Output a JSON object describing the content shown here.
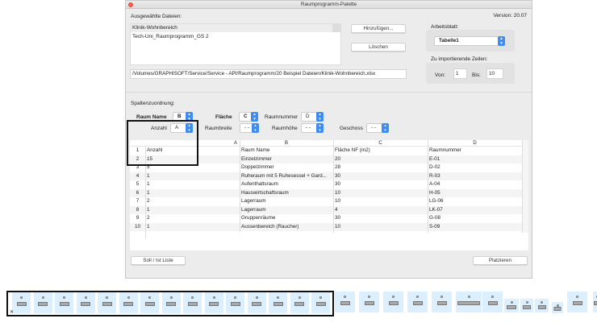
{
  "window": {
    "title": "Raumprogramm-Palette",
    "version": "Version: 20.07"
  },
  "files": {
    "label": "Ausgewählte Dateien:",
    "items": [
      "Klinik-Wohnbereich",
      "Tech-Uni_Raumprogramm_GS 2"
    ],
    "path": "/Volumes/GRAPHISOFT/Service/Service - API/Raumprogramm/20 Beispiel Dateien/Klinik-Wohnbereich.xlsx",
    "add_button": "Hinzufügen...",
    "delete_button": "Löschen"
  },
  "sheet": {
    "label": "Arbeitsblatt:",
    "value": "Tabelle1"
  },
  "rows_import": {
    "label": "Zu importierende Zeilen:",
    "from_label": "Von:",
    "from": "1",
    "to_label": "Bis:",
    "to": "10"
  },
  "mapping": {
    "label": "Spaltenzuordnung:",
    "raum_name": {
      "label": "Raum Name",
      "value": "B"
    },
    "flaeche": {
      "label": "Fläche",
      "value": "C"
    },
    "raumnummer": {
      "label": "Raumnummer",
      "value": "D"
    },
    "anzahl": {
      "label": "Anzahl",
      "value": "A"
    },
    "raumbreite": {
      "label": "Raumbreite",
      "value": "- -"
    },
    "raumhoehe": {
      "label": "Raumhöhe",
      "value": "- -"
    },
    "geschoss": {
      "label": "Geschoss",
      "value": "- -"
    }
  },
  "table": {
    "columns": [
      "A",
      "B",
      "C",
      "D"
    ],
    "rows": [
      [
        "1",
        "Anzahl",
        "Raum Name",
        "Fläche NF (m2)",
        "Raumnummer"
      ],
      [
        "2",
        "15",
        "Einzelzimmer",
        "20",
        "E-01"
      ],
      [
        "3",
        "5",
        "Doppelzimmer",
        "28",
        "D-02"
      ],
      [
        "4",
        "1",
        "Ruheraum mit 5 Ruhesessel + Gard...",
        "30",
        "R-03"
      ],
      [
        "5",
        "1",
        "Aufenthaltsraum",
        "30",
        "A-04"
      ],
      [
        "6",
        "1",
        "Hauswirtschaftsraum",
        "10",
        "H-05"
      ],
      [
        "7",
        "2",
        "Lagerraum",
        "10",
        "LG-06"
      ],
      [
        "8",
        "1",
        "Lagerraum",
        "4",
        "LK-07"
      ],
      [
        "9",
        "2",
        "Gruppenräume",
        "30",
        "G-08"
      ],
      [
        "10",
        "1",
        "Aussenbereich (Raucher)",
        "10",
        "S-09"
      ]
    ]
  },
  "buttons": {
    "soll_ist": "Soll / Ist Liste",
    "place": "Platzieren"
  },
  "colors": {
    "accent": "#3b8cf5",
    "tile": "#dcefff",
    "close": "#fc5f57"
  }
}
